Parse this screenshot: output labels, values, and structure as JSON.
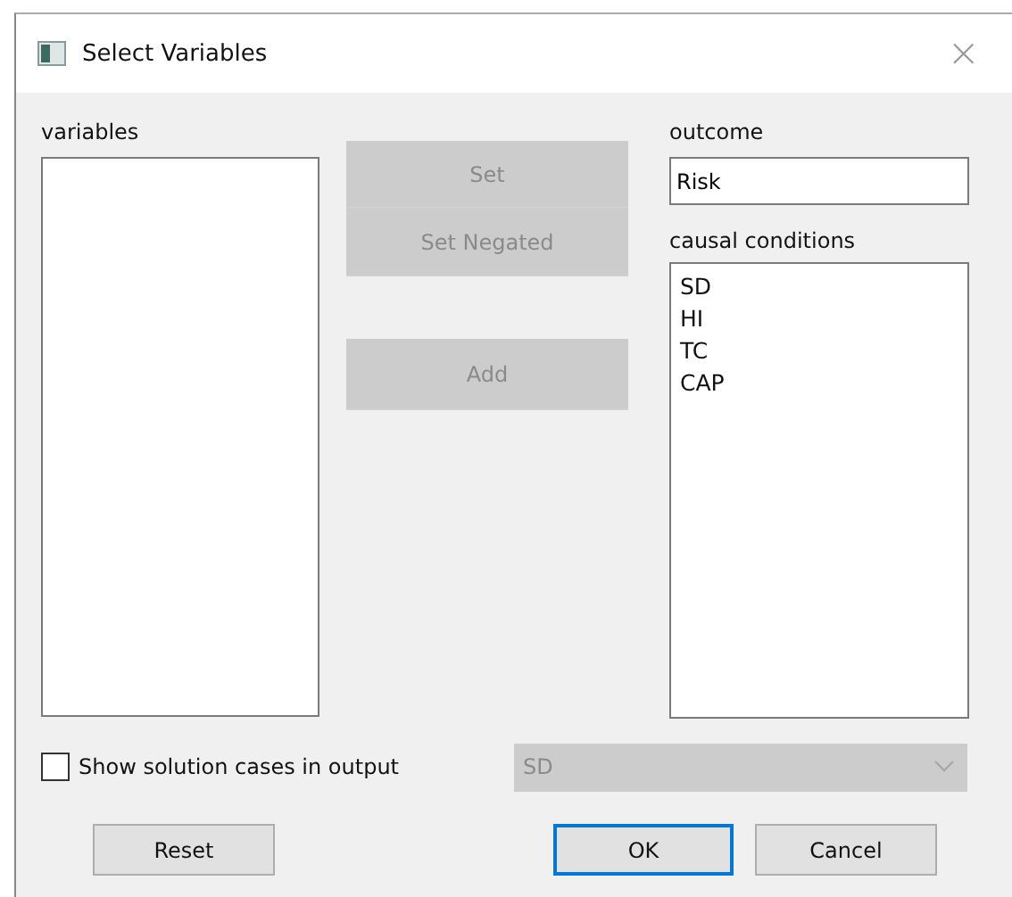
{
  "window": {
    "title": "Select Variables",
    "close": "×"
  },
  "variables": {
    "label": "variables"
  },
  "middle_buttons": [
    {
      "label": "Set",
      "disabled": true
    },
    {
      "label": "Set Negated",
      "disabled": true
    },
    {
      "label": "Add",
      "disabled": true
    }
  ],
  "outcome": {
    "label": "outcome",
    "value": "Risk"
  },
  "causal_conditions": {
    "label": "causal conditions",
    "items": [
      "SD",
      "HI",
      "TC",
      "CAP"
    ]
  },
  "show_cases": {
    "label": "Show solution cases in output",
    "checked": false
  },
  "case_dropdown": {
    "value": "SD",
    "disabled": true
  },
  "buttons": [
    {
      "label": "Reset",
      "default": false
    },
    {
      "label": "OK",
      "default": true
    },
    {
      "label": "Cancel",
      "default": false
    }
  ]
}
